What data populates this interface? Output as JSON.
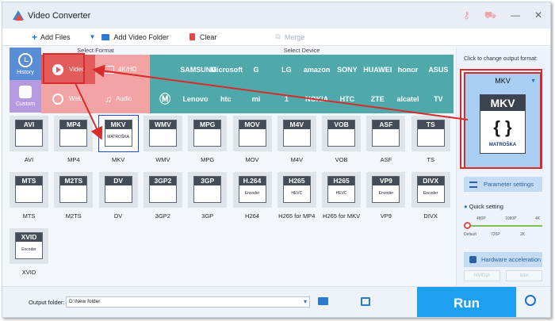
{
  "app": {
    "title": "Video Converter"
  },
  "toolbar": {
    "add_files": "Add Files",
    "add_video_folder": "Add Video Folder",
    "clear": "Clear",
    "merge": "Merge"
  },
  "sections": {
    "select_format": "Select Format",
    "select_device": "Select Device"
  },
  "left_nav": {
    "history": "History",
    "custom": "Custom"
  },
  "format_categories": {
    "video": "Video",
    "hd": "4K/HD",
    "web": "Web",
    "audio": "Audio"
  },
  "devices": {
    "row1": [
      "",
      "SAMSUNG",
      "Microsoft",
      "G",
      "LG",
      "amazon",
      "SONY",
      "HUAWEI",
      "honor",
      "ASUS"
    ],
    "row2": [
      "",
      "Lenovo",
      "htc",
      "mi",
      "1",
      "NOKIA",
      "HTC",
      "ZTE",
      "alcatel",
      "TV"
    ]
  },
  "formats": [
    {
      "name": "AVI",
      "label": "AVI",
      "sub": ""
    },
    {
      "name": "MP4",
      "label": "MP4",
      "sub": ""
    },
    {
      "name": "MKV",
      "label": "MKV",
      "sub": "MATROŠKA"
    },
    {
      "name": "WMV",
      "label": "WMV",
      "sub": ""
    },
    {
      "name": "MPG",
      "label": "MPG",
      "sub": ""
    },
    {
      "name": "MOV",
      "label": "MOV",
      "sub": ""
    },
    {
      "name": "M4V",
      "label": "M4V",
      "sub": ""
    },
    {
      "name": "VOB",
      "label": "VOB",
      "sub": ""
    },
    {
      "name": "ASF",
      "label": "ASF",
      "sub": ""
    },
    {
      "name": "TS",
      "label": "TS",
      "sub": ""
    },
    {
      "name": "MTS",
      "label": "MTS",
      "sub": ""
    },
    {
      "name": "M2TS",
      "label": "M2TS",
      "sub": ""
    },
    {
      "name": "DV",
      "label": "DV",
      "sub": ""
    },
    {
      "name": "3GP2",
      "label": "3GP2",
      "sub": ""
    },
    {
      "name": "3GP",
      "label": "3GP",
      "sub": ""
    },
    {
      "name": "H.264",
      "label": "H264",
      "sub": "Encoder"
    },
    {
      "name": "H265",
      "label": "H265 for MP4",
      "sub": "HEVC"
    },
    {
      "name": "H265",
      "label": "H265 for MKV",
      "sub": "HEVC"
    },
    {
      "name": "VP9",
      "label": "VP9",
      "sub": "Encoder"
    },
    {
      "name": "DIVX",
      "label": "DIVX",
      "sub": "Encoder"
    },
    {
      "name": "XVID",
      "label": "XVID",
      "sub": "Encoder"
    }
  ],
  "selected_format": "MKV",
  "output": {
    "click_label": "Click to change output format:",
    "format": "MKV",
    "icon_name": "MKV",
    "icon_sub": "MATROŠKA",
    "parameter_settings": "Parameter settings",
    "quick_setting": "Quick setting",
    "quality_top": [
      "480P",
      "1080P",
      "4K"
    ],
    "quality_bottom": [
      "Default",
      "720P",
      "2K"
    ],
    "hardware_acceleration": "Hardware acceleration",
    "gpu_nvidia": "NVIDIA",
    "gpu_intel": "Intel"
  },
  "bottom": {
    "output_folder_label": "Output folder:",
    "output_folder_value": "D:\\New folder",
    "run": "Run"
  },
  "colors": {
    "accent": "#1ea0f1",
    "format_panel": "#f3a3a3",
    "device_panel": "#4fa9aa",
    "highlight": "#d82b2b"
  }
}
